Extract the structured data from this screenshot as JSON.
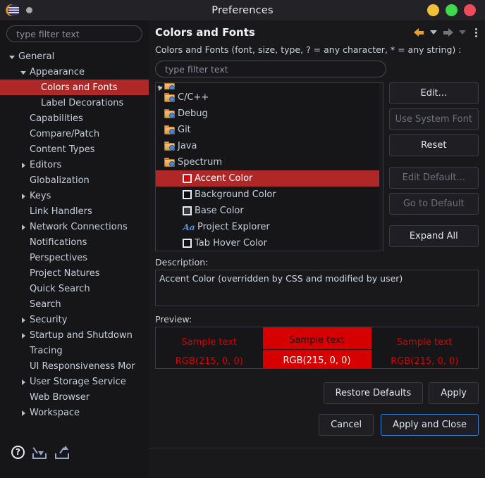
{
  "window": {
    "title": "Preferences",
    "logo_icon": "eclipse-logo",
    "dot_icon": "gray-dot",
    "controls": [
      {
        "name": "minimize-button",
        "color": "#f2c037"
      },
      {
        "name": "maximize-button",
        "color": "#3ed94f"
      },
      {
        "name": "close-button",
        "color": "#ef4a58"
      }
    ]
  },
  "sidebar": {
    "filter_placeholder": "type filter text",
    "filter_value": "",
    "items": [
      {
        "label": "General",
        "indent": 0,
        "arrow": "open",
        "selected": false
      },
      {
        "label": "Appearance",
        "indent": 1,
        "arrow": "open",
        "selected": false
      },
      {
        "label": "Colors and Fonts",
        "indent": 2,
        "arrow": "none",
        "selected": true
      },
      {
        "label": "Label Decorations",
        "indent": 2,
        "arrow": "none",
        "selected": false
      },
      {
        "label": "Capabilities",
        "indent": 1,
        "arrow": "none",
        "selected": false
      },
      {
        "label": "Compare/Patch",
        "indent": 1,
        "arrow": "none",
        "selected": false
      },
      {
        "label": "Content Types",
        "indent": 1,
        "arrow": "none",
        "selected": false
      },
      {
        "label": "Editors",
        "indent": 1,
        "arrow": "closed",
        "selected": false
      },
      {
        "label": "Globalization",
        "indent": 1,
        "arrow": "none",
        "selected": false
      },
      {
        "label": "Keys",
        "indent": 1,
        "arrow": "closed",
        "selected": false
      },
      {
        "label": "Link Handlers",
        "indent": 1,
        "arrow": "none",
        "selected": false
      },
      {
        "label": "Network Connections",
        "indent": 1,
        "arrow": "closed",
        "selected": false
      },
      {
        "label": "Notifications",
        "indent": 1,
        "arrow": "none",
        "selected": false
      },
      {
        "label": "Perspectives",
        "indent": 1,
        "arrow": "none",
        "selected": false
      },
      {
        "label": "Project Natures",
        "indent": 1,
        "arrow": "none",
        "selected": false
      },
      {
        "label": "Quick Search",
        "indent": 1,
        "arrow": "none",
        "selected": false
      },
      {
        "label": "Search",
        "indent": 1,
        "arrow": "none",
        "selected": false
      },
      {
        "label": "Security",
        "indent": 1,
        "arrow": "closed",
        "selected": false
      },
      {
        "label": "Startup and Shutdown",
        "indent": 1,
        "arrow": "closed",
        "selected": false
      },
      {
        "label": "Tracing",
        "indent": 1,
        "arrow": "none",
        "selected": false
      },
      {
        "label": "UI Responsiveness Mor",
        "indent": 1,
        "arrow": "none",
        "selected": false
      },
      {
        "label": "User Storage Service",
        "indent": 1,
        "arrow": "closed",
        "selected": false
      },
      {
        "label": "Web Browser",
        "indent": 1,
        "arrow": "none",
        "selected": false
      },
      {
        "label": "Workspace",
        "indent": 1,
        "arrow": "closed",
        "selected": false
      }
    ],
    "actions": [
      {
        "name": "help-icon",
        "glyph": "?"
      },
      {
        "name": "import-preferences-icon"
      },
      {
        "name": "export-preferences-icon"
      }
    ]
  },
  "page": {
    "title": "Colors and Fonts",
    "toolbar": [
      {
        "name": "back-icon",
        "enabled": true
      },
      {
        "name": "back-dropdown-icon",
        "enabled": true
      },
      {
        "name": "forward-icon",
        "enabled": false
      },
      {
        "name": "forward-dropdown-icon",
        "enabled": false
      },
      {
        "name": "menu-kebab-icon",
        "enabled": true
      }
    ],
    "filter_caption": "Colors and Fonts (font, size, type, ? = any character, * = any string) :",
    "filter_placeholder": "type filter text",
    "filter_value": "",
    "color_tree": [
      {
        "label": "C/C++",
        "type": "folder",
        "arrow": "closed",
        "selected": false
      },
      {
        "label": "Debug",
        "type": "folder",
        "arrow": "closed",
        "selected": false
      },
      {
        "label": "Git",
        "type": "folder",
        "arrow": "closed",
        "selected": false
      },
      {
        "label": "Java",
        "type": "folder",
        "arrow": "closed",
        "selected": false
      },
      {
        "label": "Spectrum",
        "type": "folder",
        "arrow": "open",
        "selected": false
      },
      {
        "label": "Accent Color",
        "type": "color",
        "swatch": "#e00000",
        "selected": true
      },
      {
        "label": "Background Color",
        "type": "color",
        "swatch": "#0c0c0e",
        "selected": false
      },
      {
        "label": "Base Color",
        "type": "color",
        "swatch": "#3a3a40",
        "selected": false
      },
      {
        "label": "Project Explorer",
        "type": "font",
        "selected": false
      },
      {
        "label": "Tab Hover Color",
        "type": "color",
        "swatch": "#121215",
        "selected": false
      }
    ],
    "side_buttons": [
      {
        "label": "Edit...",
        "enabled": true,
        "gap": false
      },
      {
        "label": "Use System Font",
        "enabled": false,
        "gap": false
      },
      {
        "label": "Reset",
        "enabled": true,
        "gap": false
      },
      {
        "label": "Edit Default...",
        "enabled": false,
        "gap": true
      },
      {
        "label": "Go to Default",
        "enabled": false,
        "gap": false
      },
      {
        "label": "Expand All",
        "enabled": true,
        "gap": true
      }
    ],
    "description_label": "Description:",
    "description_text": "Accent Color (overridden by CSS and modified by user)",
    "preview_label": "Preview:",
    "preview_cells": [
      {
        "sample": "Sample text",
        "rgb": "RGB(215, 0, 0)",
        "highlighted": false
      },
      {
        "sample": "Sample text",
        "rgb": "RGB(215, 0, 0)",
        "highlighted": true
      },
      {
        "sample": "Sample text",
        "rgb": "RGB(215, 0, 0)",
        "highlighted": false
      }
    ],
    "accent_color": "#d70000",
    "mid_buttons": [
      {
        "label": "Restore Defaults",
        "focus": false
      },
      {
        "label": "Apply",
        "focus": false
      }
    ],
    "bottom_buttons": [
      {
        "label": "Cancel",
        "focus": false
      },
      {
        "label": "Apply and Close",
        "focus": true
      }
    ]
  }
}
